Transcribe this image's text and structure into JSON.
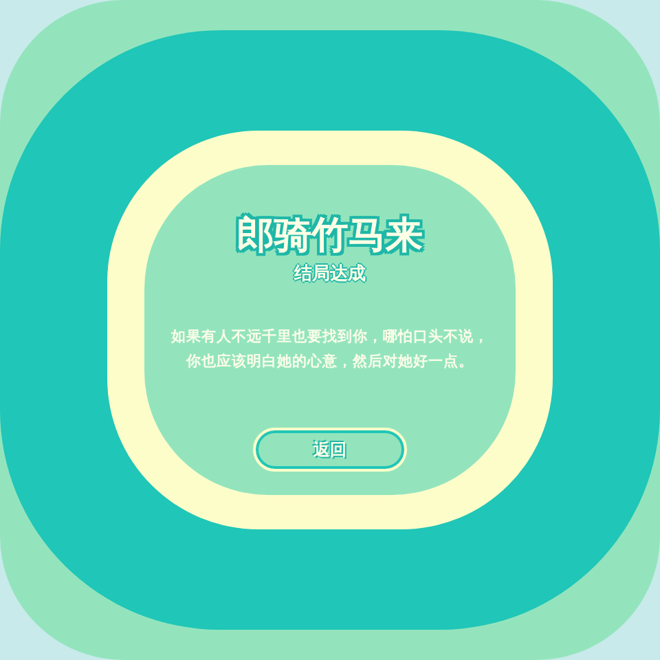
{
  "ending": {
    "title": "郎骑竹马来",
    "subtitle": "结局达成",
    "message": [
      "如果有人不远千里也要找到你，哪怕口头不说，",
      "你也应该明白她的心意，然后对她好一点。"
    ],
    "button": "返回"
  }
}
